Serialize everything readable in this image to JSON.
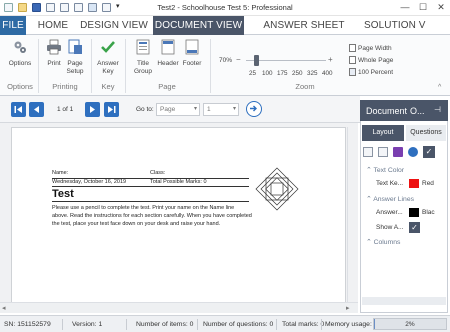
{
  "window": {
    "title": "Test2 - Schoolhouse Test 5: Professional"
  },
  "tabs": {
    "file": "FILE",
    "home": "HOME",
    "design": "DESIGN VIEW",
    "document": "DOCUMENT VIEW",
    "answer_sheet": "ANSWER SHEET VIEW",
    "solution": "SOLUTION V"
  },
  "ribbon": {
    "options": {
      "btn": "Options",
      "group": "Options"
    },
    "printing": {
      "print": "Print",
      "page_setup_1": "Page",
      "page_setup_2": "Setup",
      "group": "Printing"
    },
    "key": {
      "answer_key_1": "Answer",
      "answer_key_2": "Key",
      "group": "Key"
    },
    "page": {
      "title_group_1": "Title",
      "title_group_2": "Group",
      "header": "Header",
      "footer": "Footer",
      "group": "Page"
    },
    "zoom": {
      "current": "70%",
      "ticks": [
        "25",
        "100",
        "175",
        "250",
        "325",
        "400"
      ],
      "page_width": "Page Width",
      "whole_page": "Whole Page",
      "hundred": "100 Percent",
      "group": "Zoom",
      "level_percent": 70,
      "min": 25,
      "max": 400
    }
  },
  "navbar": {
    "page_of": "1 of 1",
    "goto_label": "Go to:",
    "goto_type": "Page",
    "goto_value": "1"
  },
  "document": {
    "name_label": "Name:",
    "class_label": "Class:",
    "date": "Wednesday, October 16, 2019",
    "marks": "Total Possible Marks: 0",
    "heading": "Test",
    "instructions": "Please use a pencil to complete the test. Print your name on the Name line above. Read the instructions for each section carefully. When you have completed the test, place your test face down on your desk and raise your hand."
  },
  "panel": {
    "title": "Document",
    "title_extra": "O...",
    "tab_layout": "Layout",
    "tab_questions": "Questions",
    "text_color_section": "Text Color",
    "text_key_label": "Text Ke...",
    "text_key_value": "Red",
    "answer_lines_section": "Answer Lines",
    "answer_label": "Answer...",
    "answer_value": "Blac",
    "show_label": "Show A...",
    "columns_section": "Columns",
    "colors": {
      "red": "#ee1111",
      "black": "#000000",
      "accent": "#4a5568"
    }
  },
  "status": {
    "sn": "SN: 151152579",
    "version": "Version: 1",
    "items": "Number of items: 0",
    "questions": "Number of questions: 0",
    "marks": "Total marks: 0",
    "memory_label": "Memory usage:",
    "memory_value": "2%",
    "memory_fraction": 0.02
  }
}
